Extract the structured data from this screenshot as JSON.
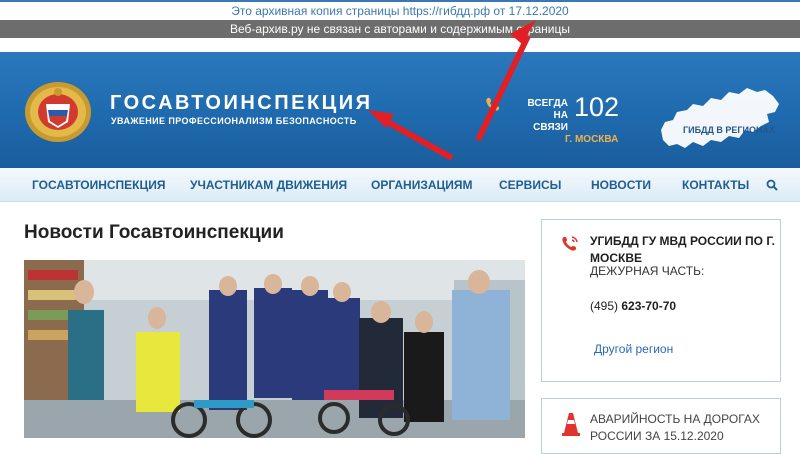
{
  "archive": {
    "copy_notice": "Это архивная копия страницы https://гибдд.рф от 17.12.2020",
    "disclaimer": "Веб-архив.ру не связан с авторами и содержимым страницы"
  },
  "header": {
    "title": "ГОСАВТОИНСПЕКЦИЯ",
    "subtitle": "УВАЖЕНИЕ ПРОФЕССИОНАЛИЗМ БЕЗОПАСНОСТЬ",
    "always_line1": "ВСЕГДА",
    "always_line2": "НА СВЯЗИ",
    "phone_number": "102",
    "city": "Г. МОСКВА",
    "regions_label": "ГИБДД В РЕГИОНАХ"
  },
  "nav": {
    "items": [
      "ГОСАВТОИНСПЕКЦИЯ",
      "УЧАСТНИКАМ ДВИЖЕНИЯ",
      "ОРГАНИЗАЦИЯМ",
      "СЕРВИСЫ",
      "НОВОСТИ",
      "КОНТАКТЫ"
    ]
  },
  "main": {
    "title": "Новости Госавтоинспекции"
  },
  "sidebar": {
    "contact": {
      "org": "УГИБДД ГУ МВД РОССИИ ПО Г. МОСКВЕ",
      "duty": "ДЕЖУРНАЯ ЧАСТЬ:",
      "phone_code": "(495)",
      "phone": "623-70-70",
      "other_region": "Другой регион"
    },
    "accidents": {
      "text": "АВАРИЙНОСТЬ НА ДОРОГАХ РОССИИ ЗА 15.12.2020"
    }
  },
  "colors": {
    "header_blue": "#1f6aae",
    "nav_text": "#1f5e92",
    "accent_orange": "#f1b24a",
    "annotation_red": "#e31e24"
  },
  "icons": [
    "emblem-icon",
    "phone-icon",
    "russia-map-icon",
    "search-icon",
    "card-phone-icon",
    "traffic-cone-icon"
  ]
}
